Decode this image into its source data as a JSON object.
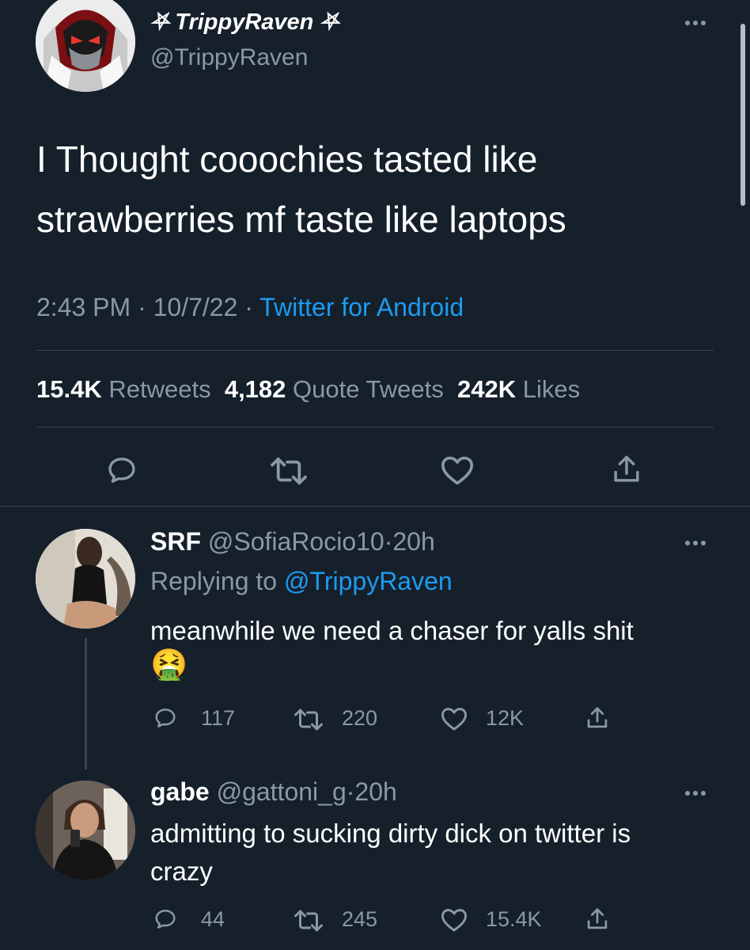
{
  "main_tweet": {
    "display_name": "TrippyRaven",
    "name_symbol": "⛧",
    "handle": "@TrippyRaven",
    "text_line1": "I Thought cooochies tasted like",
    "text_line2": "strawberries mf taste like laptops",
    "time": "2:43 PM",
    "date": "10/7/22",
    "dot": "·",
    "source": "Twitter for Android",
    "stats": {
      "retweets_count": "15.4K",
      "retweets_label": "Retweets",
      "quotes_count": "4,182",
      "quotes_label": "Quote Tweets",
      "likes_count": "242K",
      "likes_label": "Likes"
    }
  },
  "replies": [
    {
      "display_name": "SRF",
      "handle": "@SofiaRocio10",
      "dot": "·",
      "time": "20h",
      "replying_prefix": "Replying to",
      "replying_to": "@TrippyRaven",
      "text_line1": "meanwhile we need a chaser for yalls shit",
      "emoji": "🤮",
      "replies": "117",
      "retweets": "220",
      "likes": "12K"
    },
    {
      "display_name": "gabe",
      "handle": "@gattoni_g",
      "dot": "·",
      "time": "20h",
      "text_line1": "admitting to sucking dirty dick on twitter is",
      "text_line2": "crazy",
      "replies": "44",
      "retweets": "245",
      "likes": "15.4K"
    }
  ],
  "colors": {
    "background": "#15202b",
    "text": "#ffffff",
    "muted": "#8b98a5",
    "link": "#1d9bf0",
    "divider": "#38444d"
  },
  "icons": [
    "more-icon",
    "reply-icon",
    "retweet-icon",
    "like-icon",
    "share-icon"
  ]
}
